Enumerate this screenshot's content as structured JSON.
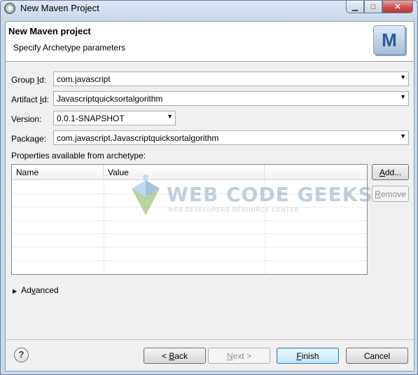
{
  "window": {
    "title": "New Maven Project",
    "buttons": {
      "minimize": "▁",
      "maximize": "□",
      "close": "✕"
    }
  },
  "banner": {
    "title": "New Maven project",
    "subtitle": "Specify Archetype parameters",
    "logo_letter": "M"
  },
  "form": {
    "group_id": {
      "label_pre": "Group ",
      "label_key": "I",
      "label_post": "d:",
      "value": "com.javascript"
    },
    "artifact_id": {
      "label_pre": "Artifact ",
      "label_key": "I",
      "label_post": "d:",
      "value": "Javascriptquicksortalgorithm"
    },
    "version": {
      "label_pre": "Version",
      "label_key": "",
      "label_post": ":",
      "value": "0.0.1-SNAPSHOT"
    },
    "package": {
      "label_pre": "Package",
      "label_key": "",
      "label_post": ":",
      "value": "com.javascript.Javascriptquicksortalgorithm"
    }
  },
  "properties": {
    "label": "Properties available from archetype:",
    "columns": [
      "Name",
      "Value"
    ],
    "rows": []
  },
  "side_buttons": {
    "add": {
      "pre": "",
      "key": "A",
      "post": "dd..."
    },
    "remove": {
      "pre": "",
      "key": "R",
      "post": "emove"
    }
  },
  "advanced": {
    "pre": "Ad",
    "key": "v",
    "post": "anced",
    "expander": "▶"
  },
  "watermark": {
    "title": "WEB CODE GEEKS",
    "subtitle": "WEB DEVELOPERS RESOURCE CENTER"
  },
  "footer": {
    "help": "?",
    "back": {
      "pre": "< ",
      "key": "B",
      "post": "ack"
    },
    "next": {
      "pre": "",
      "key": "N",
      "post": "ext >"
    },
    "finish": {
      "pre": "",
      "key": "F",
      "post": "inish"
    },
    "cancel": "Cancel"
  },
  "dropdown_arrow": "▼"
}
